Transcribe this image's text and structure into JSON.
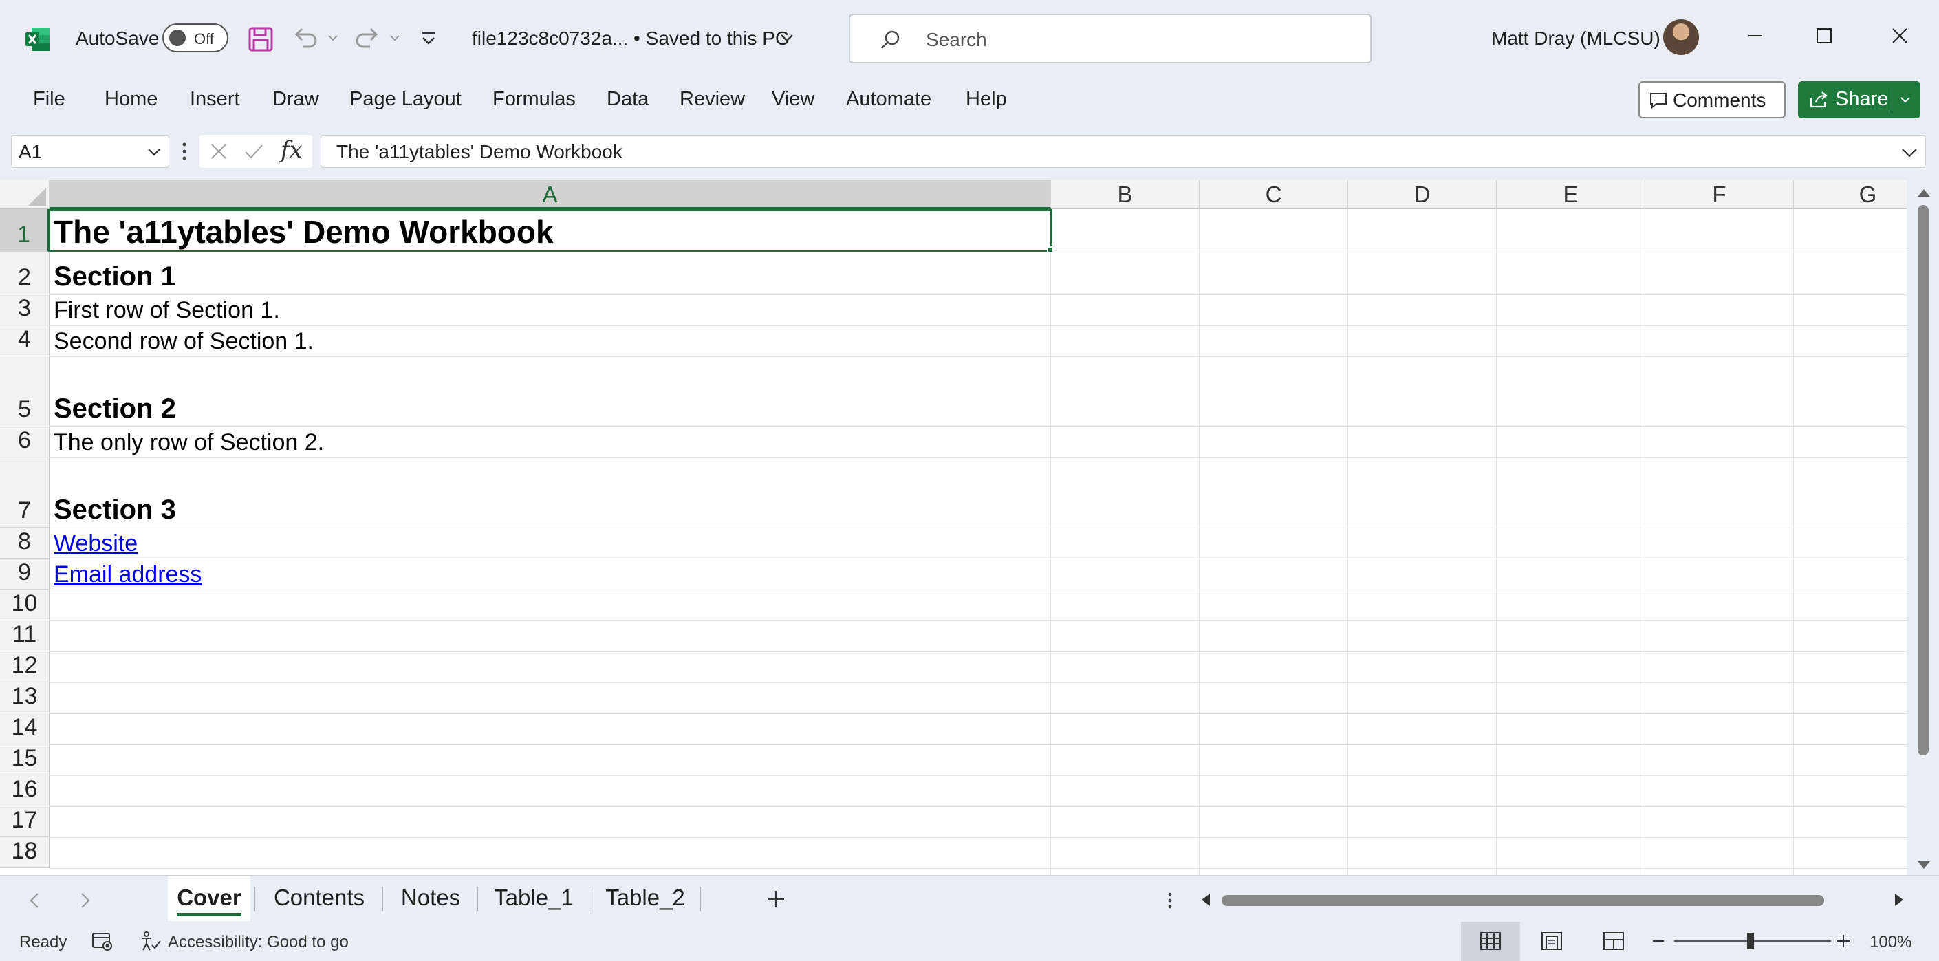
{
  "app": {
    "autosave_label": "AutoSave",
    "autosave_state": "Off",
    "file_title": "file123c8c0732a...  •  Saved to this PC",
    "search_placeholder": "Search",
    "user_name": "Matt Dray (MLCSU)",
    "accent_color": "#1e7a3c"
  },
  "ribbon": {
    "tabs": [
      "File",
      "Home",
      "Insert",
      "Draw",
      "Page Layout",
      "Formulas",
      "Data",
      "Review",
      "View",
      "Automate",
      "Help"
    ],
    "comments_label": "Comments",
    "share_label": "Share"
  },
  "formula_bar": {
    "name_box": "A1",
    "fx_label": "fx",
    "content": "The 'a11ytables' Demo Workbook"
  },
  "grid": {
    "columns": [
      "A",
      "B",
      "C",
      "D",
      "E",
      "F",
      "G"
    ],
    "selected_column": "A",
    "row_numbers": [
      "1",
      "2",
      "3",
      "4",
      "5",
      "6",
      "7",
      "8",
      "9",
      "10",
      "11",
      "12",
      "13",
      "14",
      "15",
      "16",
      "17",
      "18"
    ],
    "selected_row": "1",
    "cells": {
      "a1": "The 'a11ytables' Demo Workbook",
      "a2": "Section 1",
      "a3": "First row of Section 1.",
      "a4": "Second row of Section 1.",
      "a5": "Section 2",
      "a6": "The only row of Section 2.",
      "a7": "Section 3",
      "a8": "Website",
      "a9": "Email address"
    }
  },
  "sheets": {
    "tabs": [
      "Cover",
      "Contents",
      "Notes",
      "Table_1",
      "Table_2"
    ],
    "active": "Cover"
  },
  "status": {
    "ready": "Ready",
    "accessibility": "Accessibility: Good to go",
    "zoom": "100%"
  }
}
